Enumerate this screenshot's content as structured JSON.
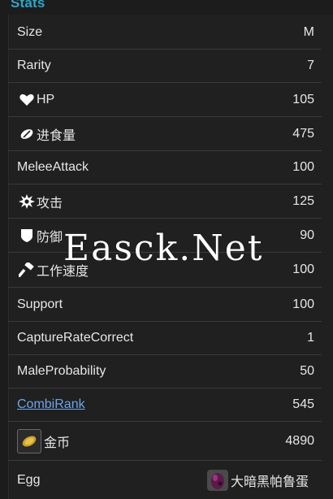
{
  "section": {
    "title": "Stats"
  },
  "rows": [
    {
      "label": "Size",
      "value": "M",
      "icon": null
    },
    {
      "label": "Rarity",
      "value": "7",
      "icon": null
    },
    {
      "label": "HP",
      "value": "105",
      "icon": "heart-icon"
    },
    {
      "label": "进食量",
      "value": "475",
      "icon": "food-icon"
    },
    {
      "label": "MeleeAttack",
      "value": "100",
      "icon": null
    },
    {
      "label": "攻击",
      "value": "125",
      "icon": "attack-burst-icon"
    },
    {
      "label": "防御",
      "value": "90",
      "icon": "shield-icon"
    },
    {
      "label": "工作速度",
      "value": "100",
      "icon": "hammer-icon"
    },
    {
      "label": "Support",
      "value": "100",
      "icon": null
    },
    {
      "label": "CaptureRateCorrect",
      "value": "1",
      "icon": null
    },
    {
      "label": "MaleProbability",
      "value": "50",
      "icon": null
    },
    {
      "label": "CombiRank",
      "value": "545",
      "icon": null,
      "link": true
    },
    {
      "label": "金币",
      "value": "4890",
      "icon": "gold-coin-icon"
    },
    {
      "label": "Egg",
      "value": "大暗黑帕鲁蛋",
      "icon": "dark-egg-icon"
    }
  ],
  "watermark": {
    "text": "Easck.Net"
  },
  "colors": {
    "accent": "#2aa7c9",
    "link": "#6fa3e8",
    "text": "#e6e6e6",
    "divider": "#3a3a3a",
    "background": "#202020"
  }
}
